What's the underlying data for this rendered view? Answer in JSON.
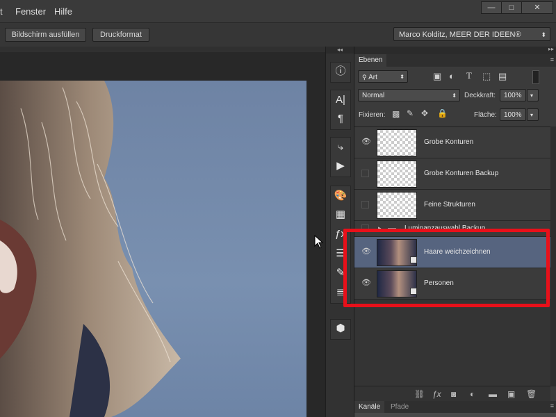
{
  "menubar": {
    "items": [
      "t",
      "Fenster",
      "Hilfe"
    ],
    "window_controls": [
      "—",
      "□",
      "✕"
    ]
  },
  "options_bar": {
    "fill_screen_label": "Bildschirm ausfüllen",
    "print_size_label": "Druckformat",
    "workspace_value": "Marco Kolditz, MEER DER IDEEN®"
  },
  "layers_panel": {
    "tab_label": "Ebenen",
    "filter_kind": "Art",
    "blend_mode": "Normal",
    "opacity_label": "Deckkraft:",
    "opacity_value": "100%",
    "lock_label": "Fixieren:",
    "fill_label": "Fläche:",
    "fill_value": "100%",
    "layers": [
      {
        "name": "Grobe Konturen",
        "visible": true,
        "thumb": "transparent",
        "selected": false
      },
      {
        "name": "Grobe Konturen Backup",
        "visible": false,
        "thumb": "transparent",
        "selected": false
      },
      {
        "name": "Feine Strukturen",
        "visible": false,
        "thumb": "transparent",
        "selected": false
      },
      {
        "name": "Luminanzauswahl Backup",
        "visible": false,
        "thumb": "group",
        "selected": false
      },
      {
        "name": "Haare weichzeichnen",
        "visible": true,
        "thumb": "photo",
        "selected": true
      },
      {
        "name": "Personen",
        "visible": true,
        "thumb": "photo",
        "selected": false
      }
    ],
    "footer_icons": [
      "link-icon",
      "fx-icon",
      "mask-icon",
      "adjustment-icon",
      "folder-icon",
      "new-layer-icon",
      "trash-icon"
    ]
  },
  "bottom_panel": {
    "tabs": [
      "Kanäle",
      "Pfade"
    ]
  },
  "colors": {
    "highlight": "#e8101a",
    "selected_row": "#56647f",
    "photo_bg": "#7990b0"
  }
}
